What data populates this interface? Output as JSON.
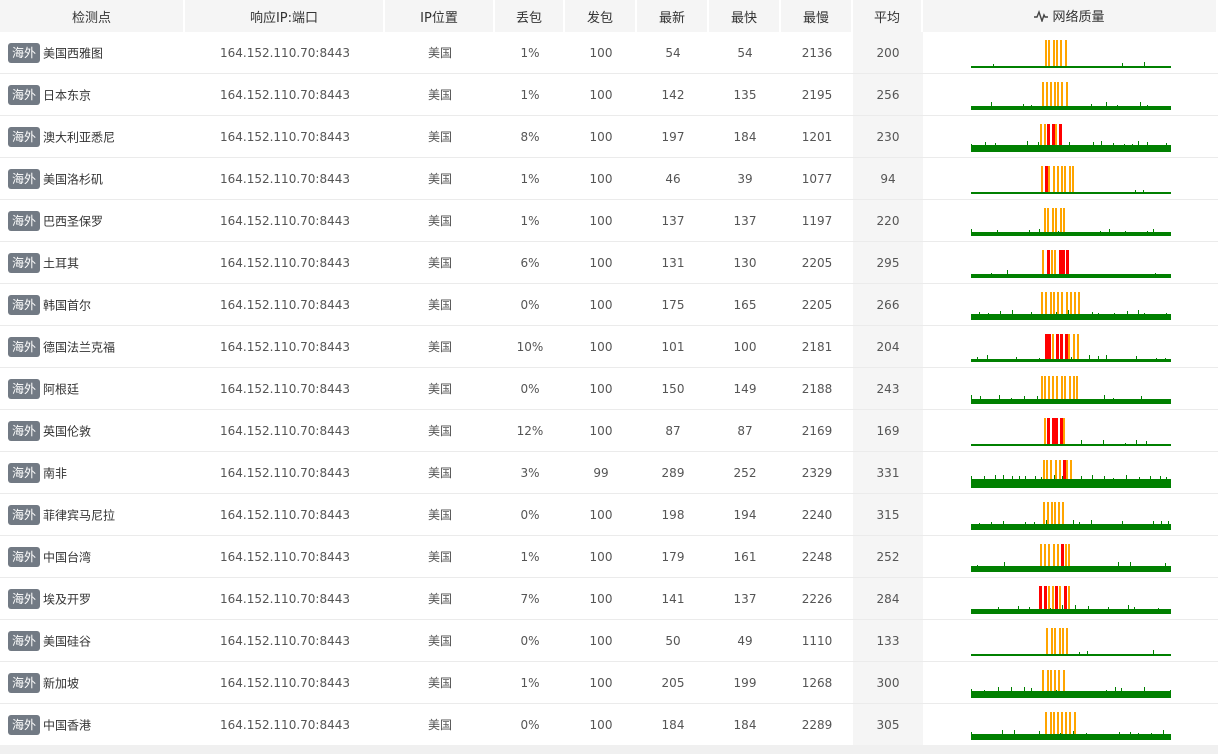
{
  "headers": {
    "site": "检测点",
    "ip": "响应IP:端口",
    "location": "IP位置",
    "loss": "丢包",
    "sent": "发包",
    "latest": "最新",
    "fastest": "最快",
    "slowest": "最慢",
    "avg": "平均",
    "quality": "网络质量"
  },
  "colors": {
    "good": "#008000",
    "warn": "#ffa500",
    "bad": "#ff0000",
    "tag_bg": "#727a84"
  },
  "rows": [
    {
      "tag": "海外",
      "site": "美国西雅图",
      "ip": "164.152.110.70:8443",
      "loc": "美国",
      "loss": "1%",
      "sent": "100",
      "latest": "54",
      "fastest": "54",
      "slowest": "2136",
      "avg": "200",
      "level": 0.12
    },
    {
      "tag": "海外",
      "site": "日本东京",
      "ip": "164.152.110.70:8443",
      "loc": "美国",
      "loss": "1%",
      "sent": "100",
      "latest": "142",
      "fastest": "135",
      "slowest": "2195",
      "avg": "256",
      "level": 0.42
    },
    {
      "tag": "海外",
      "site": "澳大利亚悉尼",
      "ip": "164.152.110.70:8443",
      "loc": "美国",
      "loss": "8%",
      "sent": "100",
      "latest": "197",
      "fastest": "184",
      "slowest": "1201",
      "avg": "230",
      "level": 0.65
    },
    {
      "tag": "海外",
      "site": "美国洛杉矶",
      "ip": "164.152.110.70:8443",
      "loc": "美国",
      "loss": "1%",
      "sent": "100",
      "latest": "46",
      "fastest": "39",
      "slowest": "1077",
      "avg": "94",
      "level": 0.1
    },
    {
      "tag": "海外",
      "site": "巴西圣保罗",
      "ip": "164.152.110.70:8443",
      "loc": "美国",
      "loss": "1%",
      "sent": "100",
      "latest": "137",
      "fastest": "137",
      "slowest": "1197",
      "avg": "220",
      "level": 0.42
    },
    {
      "tag": "海外",
      "site": "土耳其",
      "ip": "164.152.110.70:8443",
      "loc": "美国",
      "loss": "6%",
      "sent": "100",
      "latest": "131",
      "fastest": "130",
      "slowest": "2205",
      "avg": "295",
      "level": 0.4
    },
    {
      "tag": "海外",
      "site": "韩国首尔",
      "ip": "164.152.110.70:8443",
      "loc": "美国",
      "loss": "0%",
      "sent": "100",
      "latest": "175",
      "fastest": "165",
      "slowest": "2205",
      "avg": "266",
      "level": 0.55
    },
    {
      "tag": "海外",
      "site": "德国法兰克福",
      "ip": "164.152.110.70:8443",
      "loc": "美国",
      "loss": "10%",
      "sent": "100",
      "latest": "101",
      "fastest": "100",
      "slowest": "2181",
      "avg": "204",
      "level": 0.3
    },
    {
      "tag": "海外",
      "site": "阿根廷",
      "ip": "164.152.110.70:8443",
      "loc": "美国",
      "loss": "0%",
      "sent": "100",
      "latest": "150",
      "fastest": "149",
      "slowest": "2188",
      "avg": "243",
      "level": 0.48
    },
    {
      "tag": "海外",
      "site": "英国伦敦",
      "ip": "164.152.110.70:8443",
      "loc": "美国",
      "loss": "12%",
      "sent": "100",
      "latest": "87",
      "fastest": "87",
      "slowest": "2169",
      "avg": "169",
      "level": 0.2
    },
    {
      "tag": "海外",
      "site": "南非",
      "ip": "164.152.110.70:8443",
      "loc": "美国",
      "loss": "3%",
      "sent": "99",
      "latest": "289",
      "fastest": "252",
      "slowest": "2329",
      "avg": "331",
      "level": 0.9
    },
    {
      "tag": "海外",
      "site": "菲律宾马尼拉",
      "ip": "164.152.110.70:8443",
      "loc": "美国",
      "loss": "0%",
      "sent": "100",
      "latest": "198",
      "fastest": "194",
      "slowest": "2240",
      "avg": "315",
      "level": 0.62
    },
    {
      "tag": "海外",
      "site": "中国台湾",
      "ip": "164.152.110.70:8443",
      "loc": "美国",
      "loss": "1%",
      "sent": "100",
      "latest": "179",
      "fastest": "161",
      "slowest": "2248",
      "avg": "252",
      "level": 0.55
    },
    {
      "tag": "海外",
      "site": "埃及开罗",
      "ip": "164.152.110.70:8443",
      "loc": "美国",
      "loss": "7%",
      "sent": "100",
      "latest": "141",
      "fastest": "137",
      "slowest": "2226",
      "avg": "284",
      "level": 0.45
    },
    {
      "tag": "海外",
      "site": "美国硅谷",
      "ip": "164.152.110.70:8443",
      "loc": "美国",
      "loss": "0%",
      "sent": "100",
      "latest": "50",
      "fastest": "49",
      "slowest": "1110",
      "avg": "133",
      "level": 0.12
    },
    {
      "tag": "海外",
      "site": "新加坡",
      "ip": "164.152.110.70:8443",
      "loc": "美国",
      "loss": "1%",
      "sent": "100",
      "latest": "205",
      "fastest": "199",
      "slowest": "1268",
      "avg": "300",
      "level": 0.65
    },
    {
      "tag": "海外",
      "site": "中国香港",
      "ip": "164.152.110.70:8443",
      "loc": "美国",
      "loss": "0%",
      "sent": "100",
      "latest": "184",
      "fastest": "184",
      "slowest": "2289",
      "avg": "305",
      "level": 0.55
    }
  ]
}
